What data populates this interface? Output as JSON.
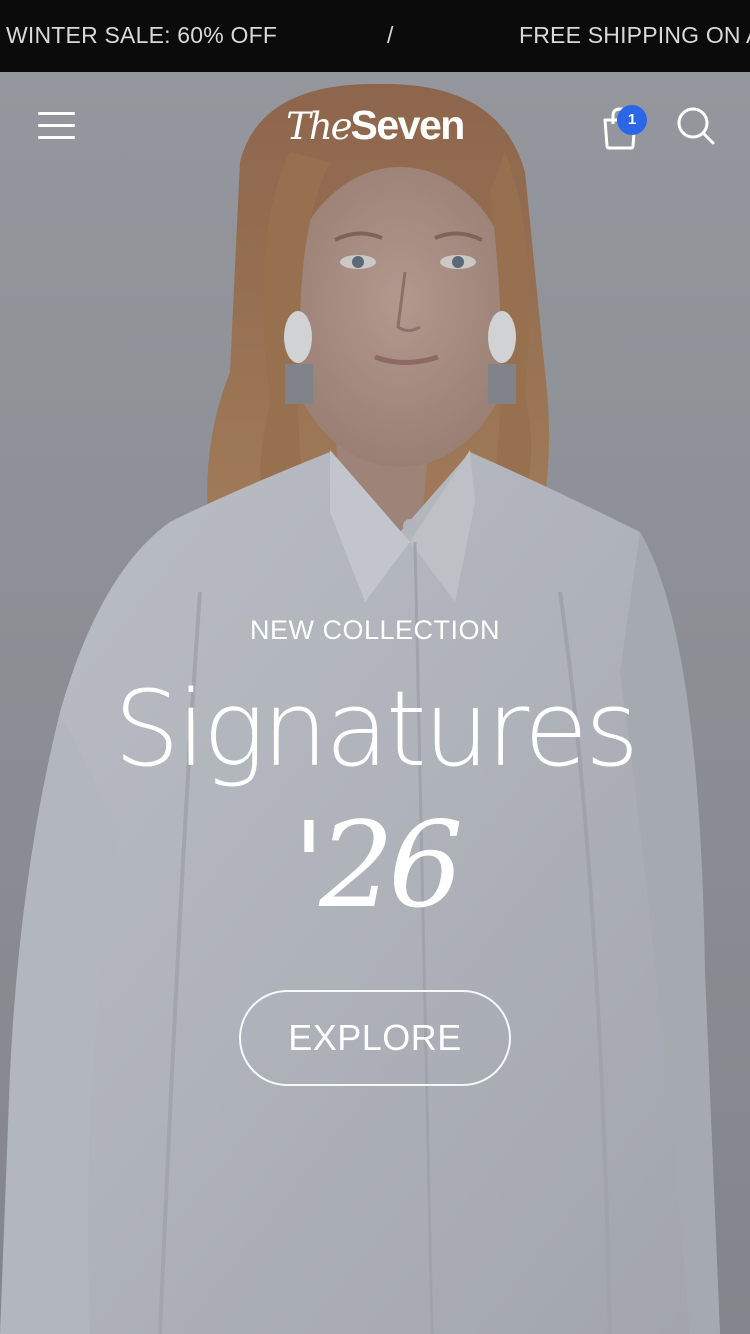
{
  "announcement": {
    "message_1": "WINTER SALE: 60% OFF",
    "separator": "/",
    "message_2": "FREE SHIPPING ON A"
  },
  "header": {
    "logo_the": "The",
    "logo_seven": "Seven",
    "cart_count": "1",
    "cart_badge_color": "#2a66e6"
  },
  "hero": {
    "eyebrow": "NEW COLLECTION",
    "title": "Signatures",
    "year": "'26",
    "cta_label": "EXPLORE"
  },
  "icons": [
    "menu-icon",
    "cart-icon",
    "search-icon"
  ]
}
